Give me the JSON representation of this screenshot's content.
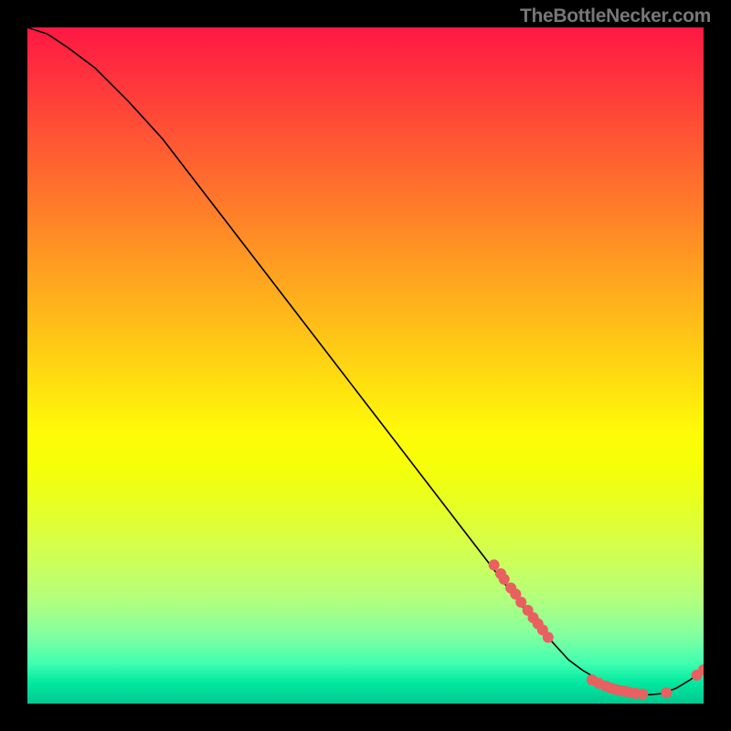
{
  "attribution": "TheBottleNecker.com",
  "chart_data": {
    "type": "line",
    "title": "",
    "xlabel": "",
    "ylabel": "",
    "xlim": [
      0,
      100
    ],
    "ylim": [
      0,
      100
    ],
    "curve": {
      "x": [
        0,
        3,
        6,
        10,
        15,
        20,
        25,
        30,
        35,
        40,
        45,
        50,
        55,
        60,
        65,
        70,
        75,
        80,
        82,
        84,
        86,
        88,
        90,
        92,
        94,
        96,
        98,
        100
      ],
      "y": [
        100,
        99,
        97,
        94,
        89,
        83.5,
        77,
        70.5,
        64,
        57.5,
        51,
        44.5,
        38,
        31.5,
        25,
        18.5,
        12,
        6.5,
        5,
        3.8,
        2.8,
        2.0,
        1.5,
        1.3,
        1.5,
        2.3,
        3.5,
        5.0
      ]
    },
    "marker_clusters": [
      {
        "label": "upper-scatter",
        "points": [
          {
            "x": 69,
            "y": 20.5
          },
          {
            "x": 70,
            "y": 19.2
          },
          {
            "x": 70.5,
            "y": 18.4
          },
          {
            "x": 71.5,
            "y": 17.1
          },
          {
            "x": 72.2,
            "y": 16.2
          },
          {
            "x": 73,
            "y": 15.0
          },
          {
            "x": 74,
            "y": 13.8
          },
          {
            "x": 74.8,
            "y": 12.7
          },
          {
            "x": 75.5,
            "y": 11.8
          },
          {
            "x": 76.2,
            "y": 10.9
          },
          {
            "x": 77,
            "y": 9.8
          }
        ]
      },
      {
        "label": "bottom-scatter",
        "points": [
          {
            "x": 83.5,
            "y": 3.5
          },
          {
            "x": 84.5,
            "y": 3.0
          },
          {
            "x": 85.5,
            "y": 2.6
          },
          {
            "x": 86.3,
            "y": 2.3
          },
          {
            "x": 87.0,
            "y": 2.1
          },
          {
            "x": 87.8,
            "y": 1.9
          },
          {
            "x": 88.5,
            "y": 1.8
          },
          {
            "x": 89.2,
            "y": 1.6
          },
          {
            "x": 90.0,
            "y": 1.5
          },
          {
            "x": 91.0,
            "y": 1.4
          },
          {
            "x": 94.5,
            "y": 1.6
          },
          {
            "x": 99.0,
            "y": 4.2
          },
          {
            "x": 100.0,
            "y": 5.0
          }
        ]
      }
    ],
    "marker_style": {
      "color": "#e86060",
      "radius_px": 6
    }
  }
}
